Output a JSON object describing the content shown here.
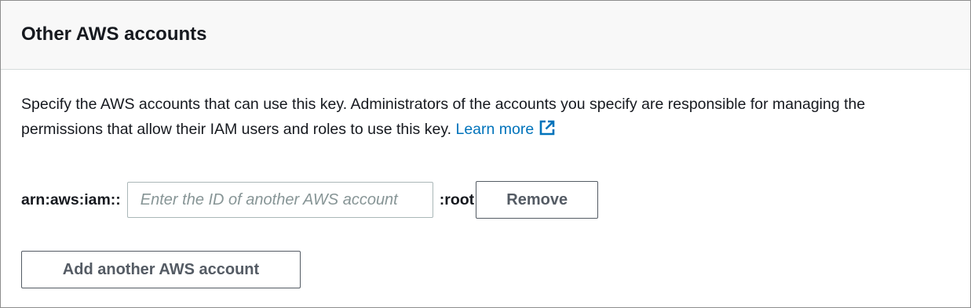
{
  "panel": {
    "title": "Other AWS accounts",
    "description": "Specify the AWS accounts that can use this key. Administrators of the accounts you specify are responsible for managing the permissions that allow their IAM users and roles to use this key.",
    "learn_more_label": "Learn more",
    "learn_more_icon": "external-link-icon",
    "link_color": "#0073bb"
  },
  "account_row": {
    "arn_prefix": "arn:aws:iam::",
    "input_value": "",
    "input_placeholder": "Enter the ID of another AWS account",
    "arn_suffix": ":root",
    "remove_label": "Remove"
  },
  "add_account_label": "Add another AWS account"
}
